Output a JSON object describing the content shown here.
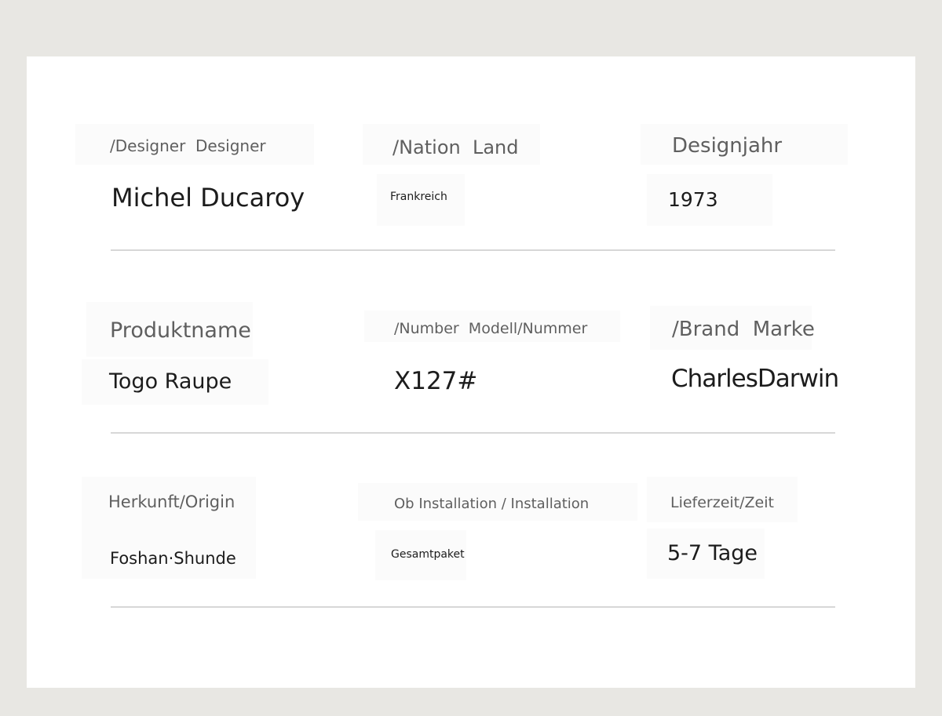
{
  "sheet": {
    "rows": [
      {
        "fields": [
          {
            "label": "/Designer  Designer",
            "value": "Michel Ducaroy"
          },
          {
            "label": "/Nation  Land",
            "value": "Frankreich"
          },
          {
            "label": "Designjahr",
            "value": "1973"
          }
        ]
      },
      {
        "fields": [
          {
            "label": "Produktname",
            "value": "Togo Raupe"
          },
          {
            "label": "/Number  Modell/Nummer",
            "value": "X127#"
          },
          {
            "label": "/Brand  Marke",
            "value": "CharlesDarwin"
          }
        ]
      },
      {
        "fields": [
          {
            "label": "Herkunft/Origin",
            "value": "Foshan·Shunde"
          },
          {
            "label": "Ob Installation / Installation",
            "value": "Gesamtpaket"
          },
          {
            "label": "Lieferzeit/Zeit",
            "value": "5-7 Tage"
          }
        ]
      }
    ]
  }
}
